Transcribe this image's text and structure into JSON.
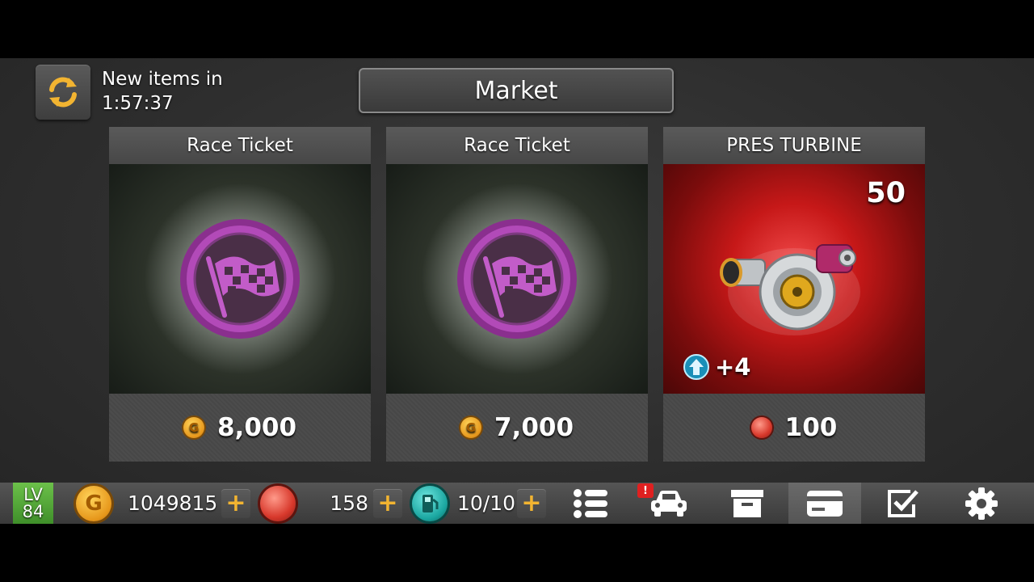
{
  "header": {
    "timer_label": "New items in",
    "timer_value": "1:57:37",
    "title": "Market"
  },
  "cards": [
    {
      "name": "Race Ticket",
      "price": "8,000",
      "currency": "gold-coin"
    },
    {
      "name": "Race Ticket",
      "price": "7,000",
      "currency": "gold-coin"
    },
    {
      "name": "PRES TURBINE",
      "price": "100",
      "currency": "gem",
      "count": "50",
      "boost": "+4"
    }
  ],
  "status": {
    "level_label": "LV",
    "level_value": "84",
    "gold": "1049815",
    "gems": "158",
    "fuel": "10/10"
  },
  "nav": {
    "alert": "!",
    "items": [
      "menu-list",
      "garage-car",
      "storage-box",
      "market-card",
      "missions-check",
      "settings-gear"
    ],
    "active": "market-card"
  },
  "colors": {
    "accent_gold": "#f2b431",
    "ticket_purple": "#b24ab8",
    "level_green": "#5aae3c",
    "turbine_bg": "#c61818"
  }
}
